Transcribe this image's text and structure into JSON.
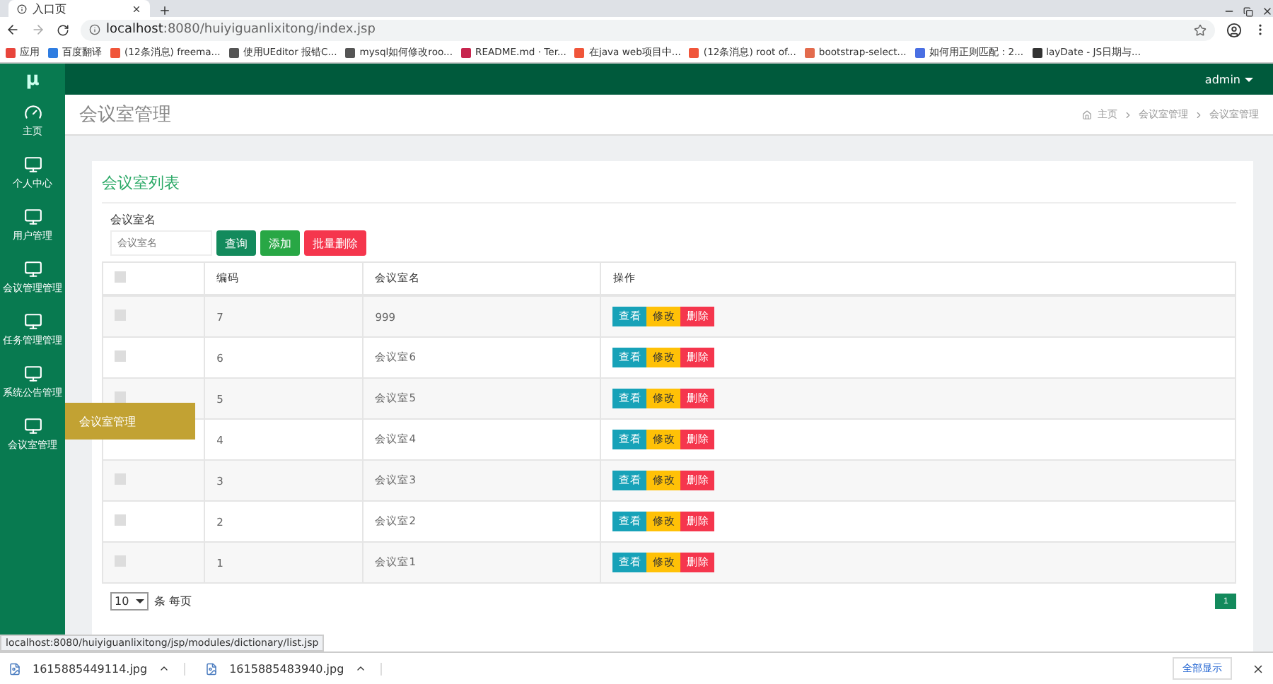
{
  "browser": {
    "tab_title": "入口页",
    "url_host": "localhost",
    "url_path": ":8080/huiyiguanlixitong/index.jsp",
    "bookmarks": [
      {
        "label": "应用",
        "color": "#e8453c"
      },
      {
        "label": "百度翻译",
        "color": "#2f7de1"
      },
      {
        "label": "(12条消息) freema...",
        "color": "#f0553a"
      },
      {
        "label": "使用UEditor 报错C...",
        "color": "#555555"
      },
      {
        "label": "mysql如何修改roo...",
        "color": "#555555"
      },
      {
        "label": "README.md · Ter...",
        "color": "#c7254e"
      },
      {
        "label": "在java web项目中...",
        "color": "#f0553a"
      },
      {
        "label": "(12条消息) root of...",
        "color": "#f0553a"
      },
      {
        "label": "bootstrap-select...",
        "color": "#e36b4d"
      },
      {
        "label": "如何用正则匹配：2...",
        "color": "#4a6fe3"
      },
      {
        "label": "layDate - JS日期与...",
        "color": "#333333"
      }
    ]
  },
  "app": {
    "logo": "μ",
    "user": "admin",
    "sidebar": [
      {
        "label": "主页",
        "kind": "gauge"
      },
      {
        "label": "个人中心",
        "kind": "monitor"
      },
      {
        "label": "用户管理",
        "kind": "monitor"
      },
      {
        "label": "会议管理管理",
        "kind": "monitor"
      },
      {
        "label": "任务管理管理",
        "kind": "monitor"
      },
      {
        "label": "系统公告管理",
        "kind": "monitor"
      },
      {
        "label": "会议室管理",
        "kind": "monitor"
      }
    ],
    "tooltip": "会议室管理",
    "page_title": "会议室管理",
    "breadcrumb": [
      "主页",
      "会议室管理",
      "会议室管理"
    ],
    "card_title": "会议室列表",
    "filter_label": "会议室名",
    "filter_placeholder": "会议室名",
    "buttons": [
      {
        "label": "查询",
        "kind": "search"
      },
      {
        "label": "添加",
        "kind": "add"
      },
      {
        "label": "批量删除",
        "kind": "delete"
      }
    ],
    "table": {
      "columns": [
        "编码",
        "会议室名",
        "操作"
      ],
      "all_checked": false,
      "rows": [
        {
          "code": "7",
          "name": "999",
          "checked": false
        },
        {
          "code": "6",
          "name": "会议室6",
          "checked": false
        },
        {
          "code": "5",
          "name": "会议室5",
          "checked": false
        },
        {
          "code": "4",
          "name": "会议室4"
        },
        {
          "code": "3",
          "name": "会议室3",
          "checked": false
        },
        {
          "code": "2",
          "name": "会议室2",
          "checked": false
        },
        {
          "code": "1",
          "name": "会议室1",
          "checked": false
        }
      ],
      "actions": [
        [
          "查看",
          "修改",
          "删除"
        ],
        [
          "查看",
          "修改",
          "删除"
        ],
        [
          "查看",
          "修改",
          "删除"
        ],
        [
          "查看",
          "修改",
          "删除"
        ],
        [
          "查看",
          "修改",
          "删除"
        ],
        [
          "查看",
          "修改",
          "删除"
        ],
        [
          "查看",
          "修改",
          "删除"
        ]
      ]
    },
    "page_size": "10",
    "page_size_suffix": "条 每页",
    "pages": [
      {
        "label": "1",
        "selected": true
      }
    ]
  },
  "status_url": "localhost:8080/huiyiguanlixitong/jsp/modules/dictionary/list.jsp",
  "downloads": [
    "1615885449114.jpg",
    "1615885483940.jpg"
  ],
  "show_all": "全部显示"
}
